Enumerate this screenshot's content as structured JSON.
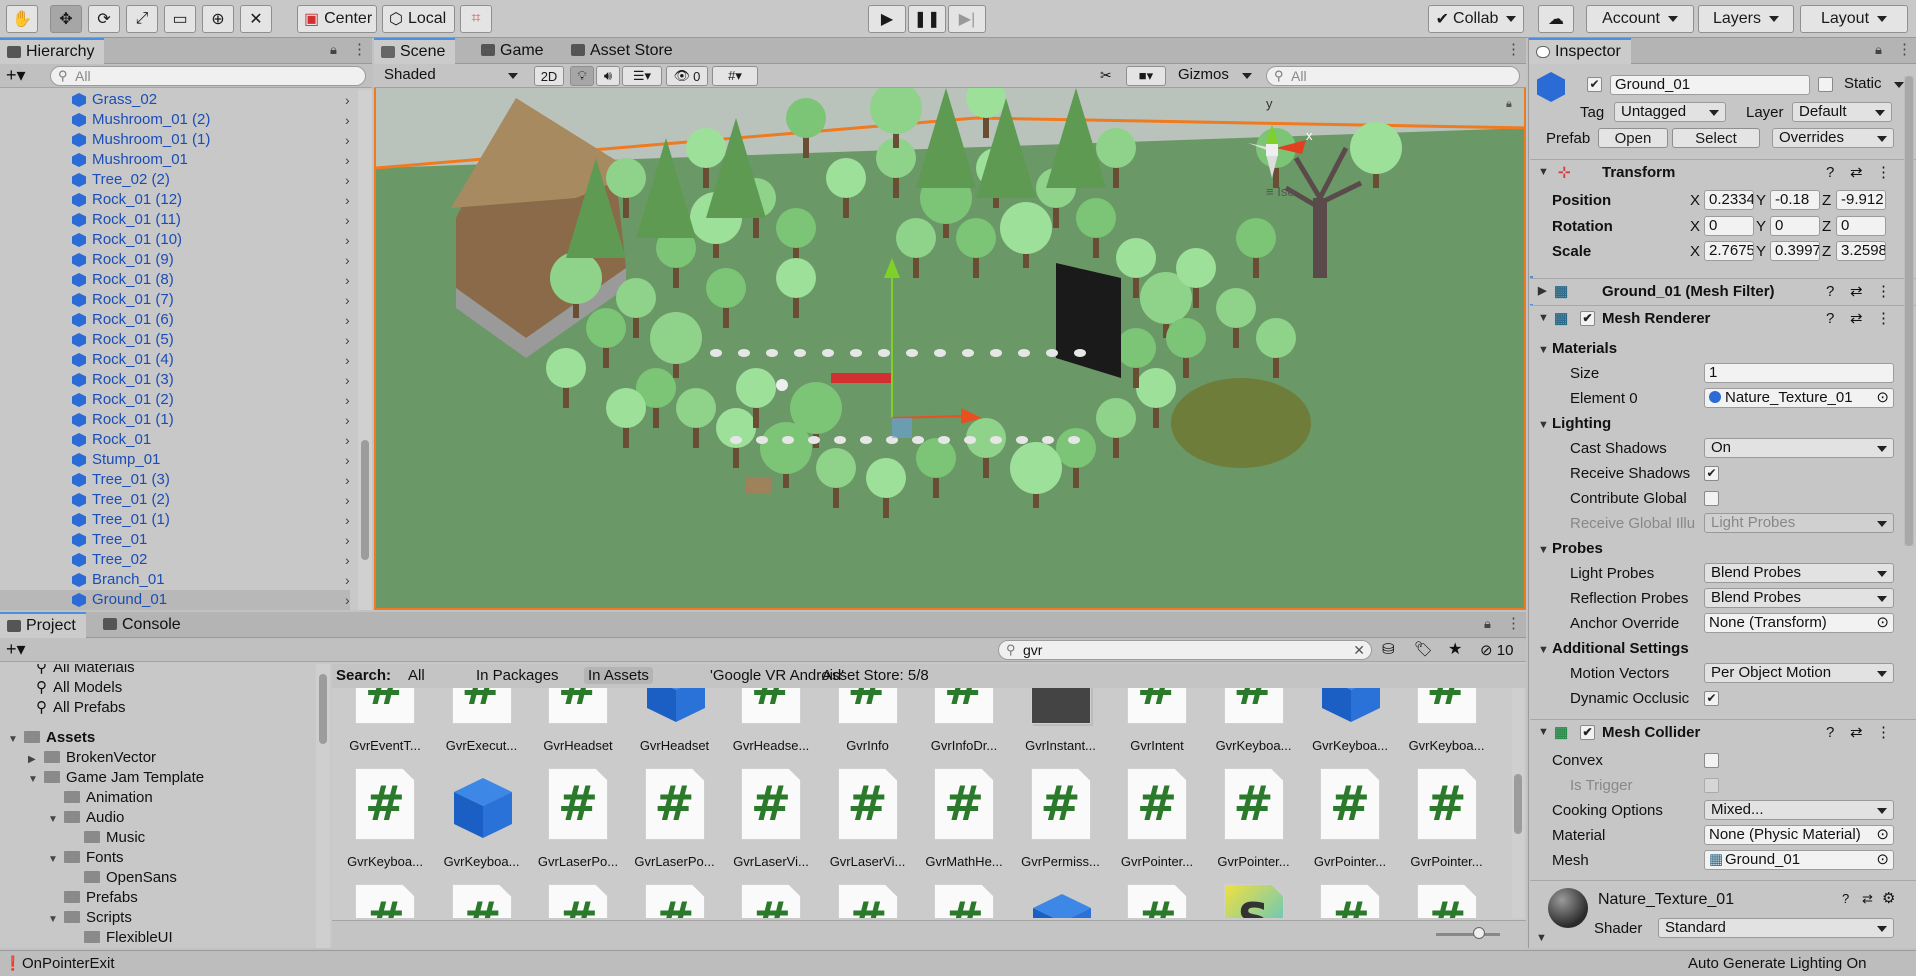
{
  "toolbar": {
    "pivot": "Center",
    "space": "Local",
    "collab": "Collab",
    "account": "Account",
    "layers": "Layers",
    "layout": "Layout"
  },
  "hierarchy": {
    "tab": "Hierarchy",
    "search_placeholder": "All",
    "items": [
      "Grass_02",
      "Mushroom_01 (2)",
      "Mushroom_01 (1)",
      "Mushroom_01",
      "Tree_02 (2)",
      "Rock_01 (12)",
      "Rock_01 (11)",
      "Rock_01 (10)",
      "Rock_01 (9)",
      "Rock_01 (8)",
      "Rock_01 (7)",
      "Rock_01 (6)",
      "Rock_01 (5)",
      "Rock_01 (4)",
      "Rock_01 (3)",
      "Rock_01 (2)",
      "Rock_01 (1)",
      "Rock_01",
      "Stump_01",
      "Tree_01 (3)",
      "Tree_01 (2)",
      "Tree_01 (1)",
      "Tree_01",
      "Tree_02",
      "Branch_01",
      "Ground_01"
    ]
  },
  "scene": {
    "tabs": [
      "Scene",
      "Game",
      "Asset Store"
    ],
    "shading": "Shaded",
    "mode2d": "2D",
    "hidden_count": "0",
    "gizmos": "Gizmos",
    "search_placeholder": "All",
    "iso_label": "Iso",
    "gizmo_y": "y",
    "gizmo_x": "x"
  },
  "inspector": {
    "tab": "Inspector",
    "object_name": "Ground_01",
    "static_label": "Static",
    "tag_label": "Tag",
    "tag_value": "Untagged",
    "layer_label": "Layer",
    "layer_value": "Default",
    "prefab_label": "Prefab",
    "prefab_open": "Open",
    "prefab_select": "Select",
    "prefab_overrides": "Overrides",
    "transform": {
      "title": "Transform",
      "position_label": "Position",
      "rotation_label": "Rotation",
      "scale_label": "Scale",
      "position": [
        "0.2334",
        "-0.18",
        "-9.912"
      ],
      "rotation": [
        "0",
        "0",
        "0"
      ],
      "scale": [
        "2.7675",
        "0.3997",
        "3.2598"
      ]
    },
    "mesh_filter_title": "Ground_01 (Mesh Filter)",
    "mesh_renderer": {
      "title": "Mesh Renderer",
      "materials": "Materials",
      "size_label": "Size",
      "size_value": "1",
      "element0_label": "Element 0",
      "element0_value": "Nature_Texture_01",
      "lighting": "Lighting",
      "cast_shadows_label": "Cast Shadows",
      "cast_shadows_value": "On",
      "receive_shadows_label": "Receive Shadows",
      "contribute_gi_label": "Contribute Global",
      "receive_gi_label": "Receive Global Illu",
      "receive_gi_value": "Light Probes",
      "probes": "Probes",
      "light_probes_label": "Light Probes",
      "light_probes_value": "Blend Probes",
      "reflection_probes_label": "Reflection Probes",
      "reflection_probes_value": "Blend Probes",
      "anchor_override_label": "Anchor Override",
      "anchor_override_value": "None (Transform)",
      "additional": "Additional Settings",
      "motion_vectors_label": "Motion Vectors",
      "motion_vectors_value": "Per Object Motion",
      "dynamic_occlusion_label": "Dynamic Occlusic"
    },
    "mesh_collider": {
      "title": "Mesh Collider",
      "convex_label": "Convex",
      "is_trigger_label": "Is Trigger",
      "cooking_label": "Cooking Options",
      "cooking_value": "Mixed...",
      "material_label": "Material",
      "material_value": "None (Physic Material)",
      "mesh_label": "Mesh",
      "mesh_value": "Ground_01"
    },
    "material": {
      "name": "Nature_Texture_01",
      "shader_label": "Shader",
      "shader_value": "Standard"
    },
    "auto_lighting": "Auto Generate Lighting On"
  },
  "project": {
    "tabs": [
      "Project",
      "Console"
    ],
    "search_value": "gvr",
    "hidden_count": "10",
    "search_label": "Search:",
    "filters": [
      "All",
      "In Packages",
      "In Assets",
      "'Google VR Android'",
      "Asset Store: 5/8"
    ],
    "tree": [
      {
        "label": "All Materials",
        "indent": 0,
        "type": "search"
      },
      {
        "label": "All Models",
        "indent": 0,
        "type": "search"
      },
      {
        "label": "All Prefabs",
        "indent": 0,
        "type": "search"
      },
      {
        "label": "Assets",
        "indent": 0,
        "type": "root"
      },
      {
        "label": "BrokenVector",
        "indent": 1,
        "type": "closed"
      },
      {
        "label": "Game Jam Template",
        "indent": 1,
        "type": "open"
      },
      {
        "label": "Animation",
        "indent": 2,
        "type": "leaf"
      },
      {
        "label": "Audio",
        "indent": 2,
        "type": "open"
      },
      {
        "label": "Music",
        "indent": 3,
        "type": "leaf"
      },
      {
        "label": "Fonts",
        "indent": 2,
        "type": "open"
      },
      {
        "label": "OpenSans",
        "indent": 3,
        "type": "leaf"
      },
      {
        "label": "Prefabs",
        "indent": 2,
        "type": "leaf"
      },
      {
        "label": "Scripts",
        "indent": 2,
        "type": "open"
      },
      {
        "label": "FlexibleUI",
        "indent": 3,
        "type": "leaf"
      }
    ],
    "row1": [
      "GvrEventT...",
      "GvrExecut...",
      "GvrHeadset",
      "GvrHeadset",
      "GvrHeadse...",
      "GvrInfo",
      "GvrInfoDr...",
      "GvrInstant...",
      "GvrIntent",
      "GvrKeyboa...",
      "GvrKeyboa...",
      "GvrKeyboa..."
    ],
    "row2": [
      "GvrKeyboa...",
      "GvrKeyboa...",
      "GvrLaserPo...",
      "GvrLaserPo...",
      "GvrLaserVi...",
      "GvrLaserVi...",
      "GvrMathHe...",
      "GvrPermiss...",
      "GvrPointer...",
      "GvrPointer...",
      "GvrPointer...",
      "GvrPointer..."
    ],
    "row1_kinds": [
      "script",
      "script",
      "script",
      "cube",
      "script",
      "script",
      "script",
      "dark",
      "script",
      "script",
      "cube",
      "script"
    ],
    "row2_kinds": [
      "script",
      "cube",
      "script",
      "script",
      "script",
      "script",
      "script",
      "script",
      "script",
      "script",
      "script",
      "script"
    ],
    "row3_kinds": [
      "script",
      "script",
      "script",
      "script",
      "script",
      "script",
      "script",
      "cube",
      "script",
      "shader",
      "script",
      "script"
    ],
    "shader_letter": "S"
  },
  "status": {
    "message": "OnPointerExit"
  },
  "colors": {
    "accent": "#4b8fe0",
    "hierarchy_text": "#1b4db5",
    "ground": "#6e9a6a",
    "selection_outline": "#f07a20",
    "script_green": "#2b7a2b",
    "prefab_blue": "#2b6bd6"
  }
}
